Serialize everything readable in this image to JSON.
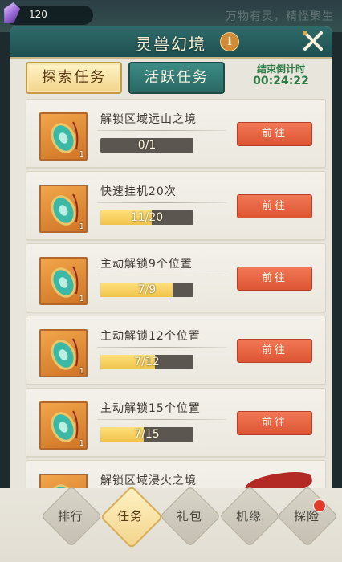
{
  "top_bar": {
    "currency_icon": "purple-gem-icon",
    "currency_amount": "120",
    "slogan": "万物有灵，精怪聚生"
  },
  "panel": {
    "title": "灵兽幻境",
    "info_icon": "i",
    "tabs": [
      {
        "label": "探索任务",
        "active": true
      },
      {
        "label": "活跃任务",
        "active": false
      }
    ],
    "countdown_label": "结束倒计时",
    "countdown_value": "00:24:22"
  },
  "tasks": [
    {
      "name": "解锁区域远山之境",
      "progress_text": "0/1",
      "progress": 0.0,
      "button": "前往",
      "reward_qty": "1"
    },
    {
      "name": "快速挂机20次",
      "progress_text": "11/20",
      "progress": 0.55,
      "button": "前往",
      "reward_qty": "1"
    },
    {
      "name": "主动解锁9个位置",
      "progress_text": "7/9",
      "progress": 0.778,
      "button": "前往",
      "reward_qty": "1"
    },
    {
      "name": "主动解锁12个位置",
      "progress_text": "7/12",
      "progress": 0.583,
      "button": "前往",
      "reward_qty": "1"
    },
    {
      "name": "主动解锁15个位置",
      "progress_text": "7/15",
      "progress": 0.467,
      "button": "前往",
      "reward_qty": "1"
    },
    {
      "name": "解锁区域浸火之境",
      "progress_text": "",
      "progress": 0.0,
      "button": "",
      "reward_qty": ""
    }
  ],
  "bottom_nav": [
    {
      "label": "排行",
      "active": false
    },
    {
      "label": "任务",
      "active": true
    },
    {
      "label": "礼包",
      "active": false
    },
    {
      "label": "机缘",
      "active": false
    },
    {
      "label": "探险",
      "active": false,
      "badge": true
    }
  ],
  "colors": {
    "accent_teal": "#2f6b6a",
    "go_button": "#dc5533",
    "progress_fill": "#f0c34a",
    "countdown_green": "#2d7a45"
  }
}
